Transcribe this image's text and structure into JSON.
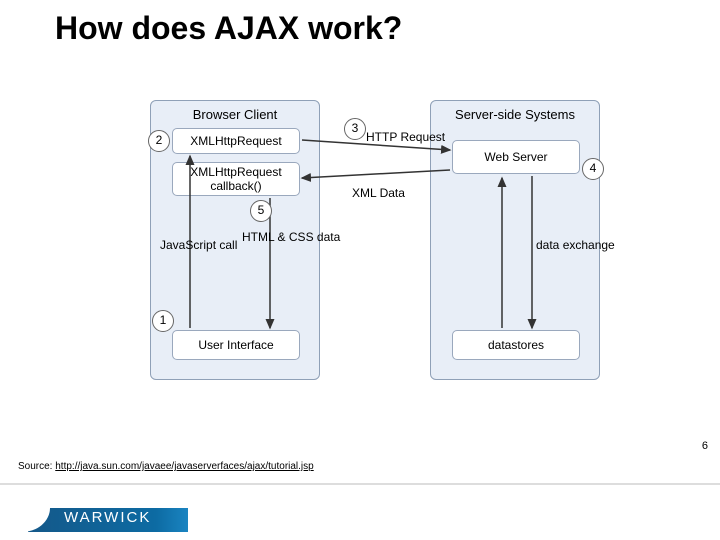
{
  "title": "How does AJAX work?",
  "page_number": "6",
  "source_prefix": "Source: ",
  "source_url": "http://java.sun.com/javaee/javaserverfaces/ajax/tutorial.jsp",
  "logo_text": "WARWICK",
  "diagram": {
    "left_panel_title": "Browser Client",
    "right_panel_title": "Server-side Systems",
    "box_xmlhttp": "XMLHttpRequest",
    "box_callback": "XMLHttpRequest callback()",
    "box_ui": "User Interface",
    "box_webserver": "Web Server",
    "box_datastores": "datastores",
    "label_http_request": "HTTP Request",
    "label_xml_data": "XML Data",
    "label_js_call": "JavaScript call",
    "label_html_css": "HTML & CSS data",
    "label_data_exchange": "data exchange",
    "num1": "1",
    "num2": "2",
    "num3": "3",
    "num4": "4",
    "num5": "5"
  }
}
